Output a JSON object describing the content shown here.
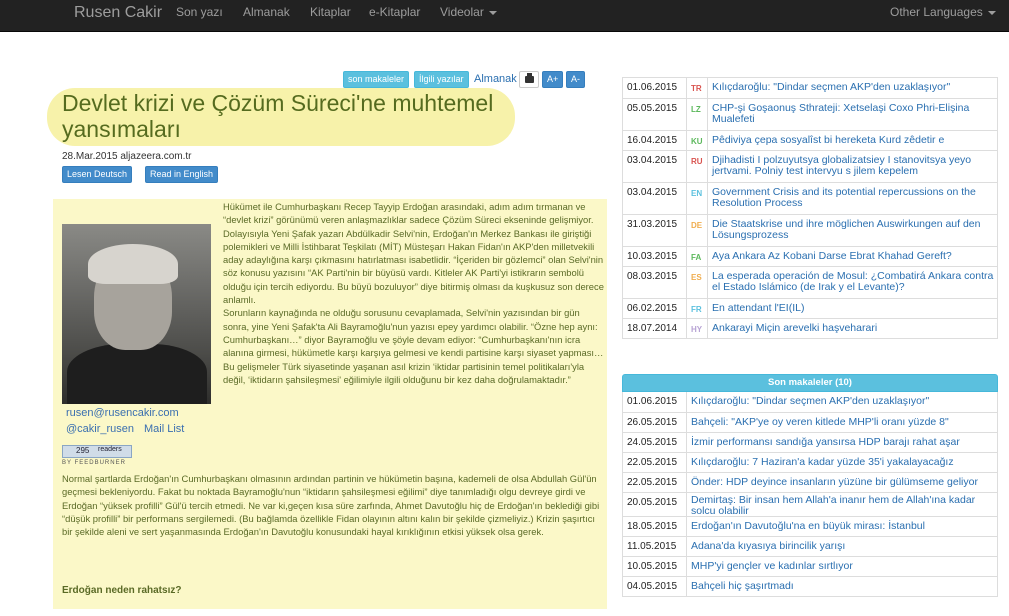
{
  "navbar": {
    "brand": "Rusen Cakir",
    "items": [
      "Son yazı",
      "Almanak",
      "Kitaplar",
      "e-Kitaplar",
      "Videolar"
    ],
    "other_languages": "Other Languages"
  },
  "article_tools": {
    "son_makaleler": "son makaleler",
    "ilgili_yazilar": "İlgili yazılar",
    "almanak": "Almanak",
    "font_up": "A+",
    "font_down": "A-"
  },
  "article": {
    "title": "Devlet krizi ve Çözüm Süreci'ne muhtemel yansımaları",
    "meta": "28.Mar.2015 aljazeera.com.tr",
    "btn_deutsch": "Lesen Deutsch",
    "btn_english": "Read in English",
    "email": "rusen@rusencakir.com",
    "twitter": "@cakir_rusen",
    "mail_list": "Mail List",
    "feed_count": "295",
    "feed_readers": "readers",
    "feed_by": "BY FEEDBURNER",
    "paragraph1": "Hükümet ile Cumhurbaşkanı Recep Tayyip Erdoğan arasındaki, adım adım tırmanan ve “devlet krizi” görünümü veren anlaşmazlıklar sadece Çözüm Süreci ekseninde gelişmiyor. Dolayısıyla Yeni Şafak yazarı Abdülkadir Selvi'nin, Erdoğan'ın Merkez Bankası ile giriştiği polemikleri ve Milli İstihbarat Teşkilatı (MİT) Müsteşarı Hakan Fidan'ın AKP'den milletvekili aday adaylığına karşı çıkmasını hatırlatması isabetlidir. “İçeriden bir gözlemci” olan Selvi'nin söz konusu yazısını “AK Parti'nin bir büyüsü vardı. Kitleler AK Parti'yi istikrarın sembolü olduğu için tercih ediyordu. Bu büyü bozuluyor” diye bitirmiş olması da kuşkusuz son derece anlamlı.",
    "paragraph1b": "Sorunların kaynağında ne olduğu sorusunu cevaplamada, Selvi'nin yazısından bir gün sonra, yine Yeni Şafak'ta Ali Bayramoğlu'nun yazısı epey yardımcı olabilir. “Özne hep aynı: Cumhurbaşkanı…” diyor Bayramoğlu ve şöyle devam ediyor: “Cumhurbaşkanı'nın icra alanına girmesi, hükümetle karşı karşıya gelmesi ve kendi partisine karşı siyaset yapması… Bu gelişmeler Türk siyasetinde yaşanan asıl krizin ‘iktidar partisinin temel politikaları'yla değil, ‘iktidarın şahsileşmesi' eğilimiyle ilgili olduğunu bir kez daha doğrulamaktadır.”",
    "paragraph2": "Normal şartlarda Erdoğan'ın Cumhurbaşkanı olmasının ardından partinin ve hükümetin başına, kademeli de olsa Abdullah Gül'ün geçmesi bekleniyordu. Fakat bu noktada Bayramoğlu'nun “iktidarın şahsileşmesi eğilimi” diye tanımladığı olgu devreye girdi ve Erdoğan “yüksek profilli” Gül'ü tercih etmedi. Ne var ki,geçen kısa süre zarfında, Ahmet Davutoğlu hiç de Erdoğan'ın beklediği gibi “düşük profilli” bir performans sergilemedi. (Bu bağlamda özellikle Fidan olayının altını kalın bir şekilde çizmeliyiz.) Krizin şaşırtıcı bir şekilde aleni ve sert yaşanmasında Erdoğan'ın Davutoğlu konusundaki hayal kırıklığının etkisi yüksek olsa gerek.",
    "subhead": "Erdoğan neden rahatsız?"
  },
  "translations": [
    {
      "date": "01.06.2015",
      "lang": "TR",
      "color": "#d9534f",
      "text": "Kılıçdaroğlu: \"Dindar seçmen AKP'den uzaklaşıyor\""
    },
    {
      "date": "05.05.2015",
      "lang": "LZ",
      "color": "#5cb85c",
      "text": "CHP-şi Goşaonuş Sthrateji: Xetselaşi Coxo Phri-Elişina Mualefeti"
    },
    {
      "date": "16.04.2015",
      "lang": "KU",
      "color": "#5cb85c",
      "text": "Pêdiviya çepa sosyalîst bi hereketa Kurd zêdetir e"
    },
    {
      "date": "03.04.2015",
      "lang": "RU",
      "color": "#d9534f",
      "text": "Djihadisti I polzuyutsya globalizatsiey I stanovitsya yeyo jertvami. Polniy test intervyu s jilem kepelem"
    },
    {
      "date": "03.04.2015",
      "lang": "EN",
      "color": "#5bc0de",
      "text": "Government Crisis and its potential repercussions on the Resolution Process"
    },
    {
      "date": "31.03.2015",
      "lang": "DE",
      "color": "#f0ad4e",
      "text": "Die Staatskrise und ihre möglichen Auswirkungen auf den Lösungsprozess"
    },
    {
      "date": "10.03.2015",
      "lang": "FA",
      "color": "#5cb85c",
      "text": "Aya Ankara Az Kobani Darse Ebrat Khahad Gereft?"
    },
    {
      "date": "08.03.2015",
      "lang": "ES",
      "color": "#f0ad4e",
      "text": "La esperada operación de Mosul: ¿Combatirá Ankara contra el Estado Islámico (de Irak y el Levante)?"
    },
    {
      "date": "06.02.2015",
      "lang": "FR",
      "color": "#5bc0de",
      "text": "En attendant l'EI(IL)"
    },
    {
      "date": "18.07.2014",
      "lang": "HY",
      "color": "#b7a3d4",
      "text": "Ankarayi Miçin arevelki haşveharari"
    }
  ],
  "recent": {
    "heading": "Son makaleler (10)",
    "items": [
      {
        "date": "01.06.2015",
        "text": "Kılıçdaroğlu: \"Dindar seçmen AKP'den uzaklaşıyor\""
      },
      {
        "date": "26.05.2015",
        "text": "Bahçeli: \"AKP'ye oy veren kitlede MHP'li oranı yüzde 8\""
      },
      {
        "date": "24.05.2015",
        "text": "İzmir performansı sandığa yansırsa HDP barajı rahat aşar"
      },
      {
        "date": "22.05.2015",
        "text": "Kılıçdaroğlu: 7 Haziran'a kadar yüzde 35'i yakalayacağız"
      },
      {
        "date": "22.05.2015",
        "text": "Önder: HDP deyince insanların yüzüne bir gülümseme geliyor"
      },
      {
        "date": "20.05.2015",
        "text": "Demirtaş: Bir insan hem Allah'a inanır hem de Allah'ına kadar solcu olabilir"
      },
      {
        "date": "18.05.2015",
        "text": "Erdoğan'ın Davutoğlu'na en büyük mirası: İstanbul"
      },
      {
        "date": "11.05.2015",
        "text": "Adana'da kıyasıya birincilik yarışı"
      },
      {
        "date": "10.05.2015",
        "text": "MHP'yi gençler ve kadınlar sırtlıyor"
      },
      {
        "date": "04.05.2015",
        "text": "Bahçeli hiç şaşırtmadı"
      }
    ]
  }
}
